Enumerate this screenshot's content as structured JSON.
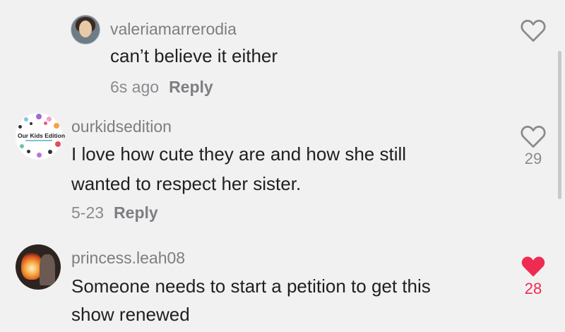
{
  "comments": [
    {
      "username": "valeriamarrerodia",
      "text": [
        "can’t believe it either"
      ],
      "time": "6s ago",
      "reply_label": "Reply",
      "likes": "",
      "liked": false
    },
    {
      "username": "ourkidsedition",
      "avatar_text": "Our Kids Edition",
      "text": [
        "I love how cute they are and how she still",
        "wanted to respect her sister."
      ],
      "time": "5-23",
      "reply_label": "Reply",
      "likes": "29",
      "liked": false
    },
    {
      "username": "princess.leah08",
      "text": [
        "Someone needs to start a petition to get this",
        "show renewed"
      ],
      "time": "",
      "reply_label": "",
      "likes": "28",
      "liked": true
    }
  ],
  "colors": {
    "background": "#f2f1f1",
    "liked_heart": "#ee2c52",
    "outline_heart": "#8a8a8f"
  },
  "icons": [
    "heart-outline-icon",
    "heart-filled-icon"
  ]
}
